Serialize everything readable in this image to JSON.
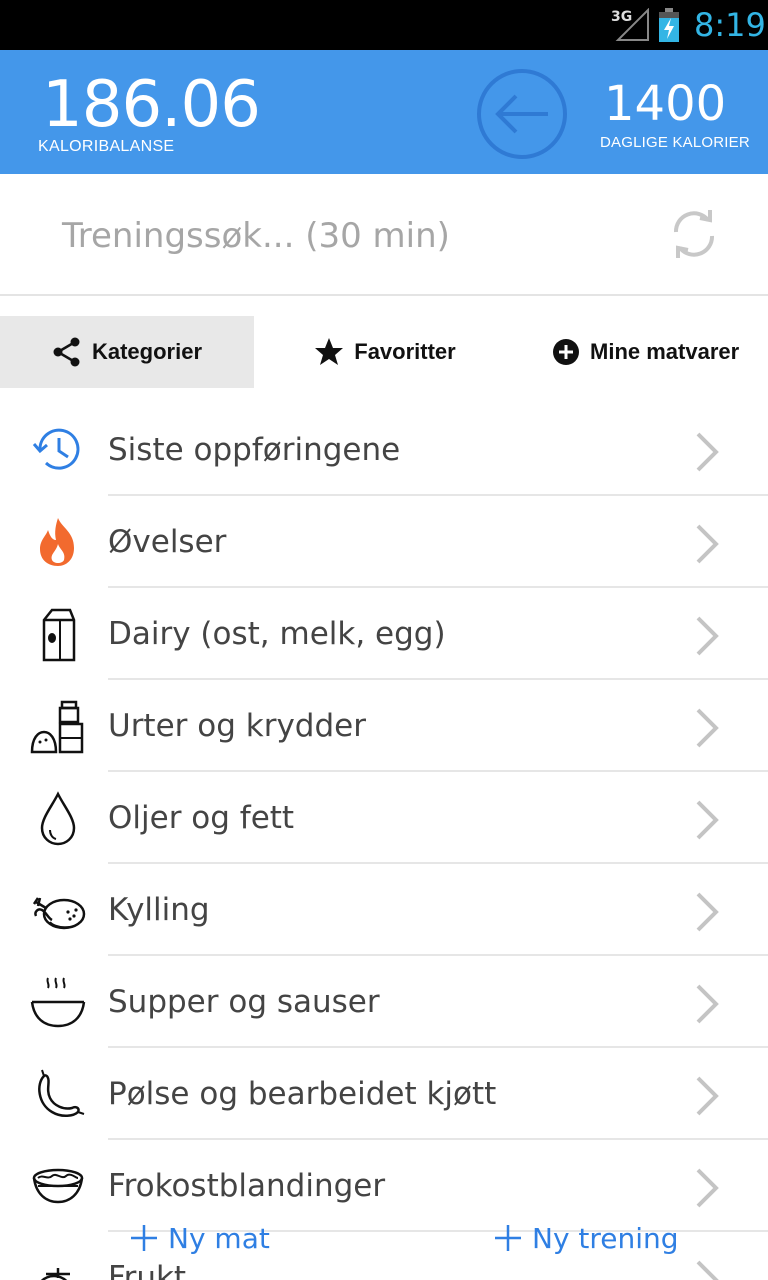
{
  "status_bar": {
    "network": "3G",
    "time": "8:19"
  },
  "header": {
    "balance_value": "186.06",
    "balance_label": "KALORIBALANSE",
    "daily_value": "1400",
    "daily_label": "DAGLIGE KALORIER"
  },
  "search": {
    "text": "Treningssøk... (30 min)"
  },
  "tabs": [
    {
      "label": "Kategorier",
      "icon": "share-icon",
      "active": true
    },
    {
      "label": "Favoritter",
      "icon": "star-icon",
      "active": false
    },
    {
      "label": "Mine matvarer",
      "icon": "plus-circle-icon",
      "active": false
    }
  ],
  "categories": [
    {
      "label": "Siste oppføringene",
      "icon": "history-clock-icon"
    },
    {
      "label": "Øvelser",
      "icon": "flame-icon"
    },
    {
      "label": "Dairy (ost, melk, egg)",
      "icon": "milk-carton-icon"
    },
    {
      "label": "Urter og krydder",
      "icon": "salt-pepper-icon"
    },
    {
      "label": "Oljer og fett",
      "icon": "oil-drop-icon"
    },
    {
      "label": "Kylling",
      "icon": "roast-chicken-icon"
    },
    {
      "label": "Supper og sauser",
      "icon": "soup-bowl-icon"
    },
    {
      "label": "Pølse og bearbeidet kjøtt",
      "icon": "sausage-icon"
    },
    {
      "label": "Frokostblandinger",
      "icon": "cereal-bowl-icon"
    },
    {
      "label": "Frukt",
      "icon": "fruit-icon"
    }
  ],
  "bottom_actions": {
    "new_food": "Ny mat",
    "new_workout": "Ny trening"
  },
  "colors": {
    "header_bg": "#4497ea",
    "accent_blue": "#2f7fe3",
    "flame_orange": "#f26a2e",
    "status_time": "#33b5e5"
  }
}
